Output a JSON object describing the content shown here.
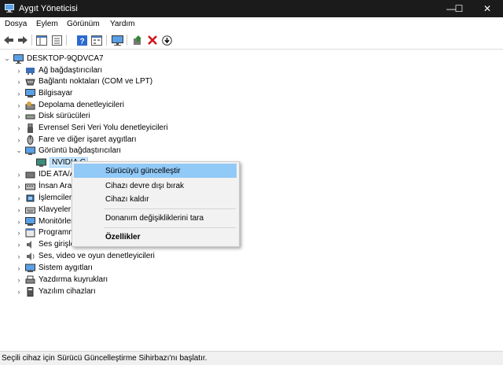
{
  "window": {
    "title": "Aygıt Yöneticisi",
    "controls": {
      "minimize": "—",
      "maximize": "☐",
      "close": "✕"
    }
  },
  "menu": {
    "items": [
      "Dosya",
      "Eylem",
      "Görünüm",
      "Yardım"
    ]
  },
  "toolbar": {
    "icons": [
      "back-icon",
      "forward-icon",
      "show-hide-tree-icon",
      "properties-icon",
      "help-icon",
      "view-icon",
      "monitor-icon",
      "add-driver-icon",
      "remove-icon",
      "update-icon"
    ],
    "colors": {
      "remove": "#d0161b",
      "add": "#2f8a2f",
      "help": "#2a6ad0"
    }
  },
  "tree": {
    "root": "DESKTOP-9QDVCA7",
    "categories": [
      {
        "label": "Ağ bağdaştırıcıları",
        "icon": "network-icon",
        "expanded": false
      },
      {
        "label": "Bağlantı noktaları (COM ve LPT)",
        "icon": "port-icon",
        "expanded": false
      },
      {
        "label": "Bilgisayar",
        "icon": "computer-icon",
        "expanded": false
      },
      {
        "label": "Depolama denetleyicileri",
        "icon": "storage-icon",
        "expanded": false
      },
      {
        "label": "Disk sürücüleri",
        "icon": "disk-icon",
        "expanded": false
      },
      {
        "label": "Evrensel Seri Veri Yolu denetleyicileri",
        "icon": "usb-icon",
        "expanded": false
      },
      {
        "label": "Fare ve diğer işaret aygıtları",
        "icon": "mouse-icon",
        "expanded": false
      },
      {
        "label": "Görüntü bağdaştırıcıları",
        "icon": "display-adapter-icon",
        "expanded": true
      },
      {
        "label": "IDE ATA/ATA",
        "icon": "ide-icon",
        "expanded": false
      },
      {
        "label": "İnsan Arabiri",
        "icon": "hid-icon",
        "expanded": false
      },
      {
        "label": "İşlemciler",
        "icon": "processor-icon",
        "expanded": false
      },
      {
        "label": "Klavyeler",
        "icon": "keyboard-icon",
        "expanded": false
      },
      {
        "label": "Monitörler",
        "icon": "monitor-icon",
        "expanded": false
      },
      {
        "label": "Programmin",
        "icon": "software-icon",
        "expanded": false
      },
      {
        "label": "Ses girişleri v",
        "icon": "audio-input-icon",
        "expanded": false
      },
      {
        "label": "Ses, video ve oyun denetleyicileri",
        "icon": "speaker-icon",
        "expanded": false
      },
      {
        "label": "Sistem aygıtları",
        "icon": "system-device-icon",
        "expanded": false
      },
      {
        "label": "Yazdırma kuyrukları",
        "icon": "printer-icon",
        "expanded": false
      },
      {
        "label": "Yazılım cihazları",
        "icon": "software-device-icon",
        "expanded": false
      }
    ],
    "child_device": "NVIDIA G"
  },
  "context_menu": {
    "items": [
      "Sürücüyü güncelleştir",
      "Cihazı devre dışı bırak",
      "Cihazı kaldır",
      "Donanım değişikliklerini tara",
      "Özellikler"
    ],
    "highlighted": "Sürücüyü güncelleştir"
  },
  "status_bar": {
    "text": "Seçili cihaz için Sürücü Güncelleştirme Sihirbazı'nı başlatır."
  }
}
